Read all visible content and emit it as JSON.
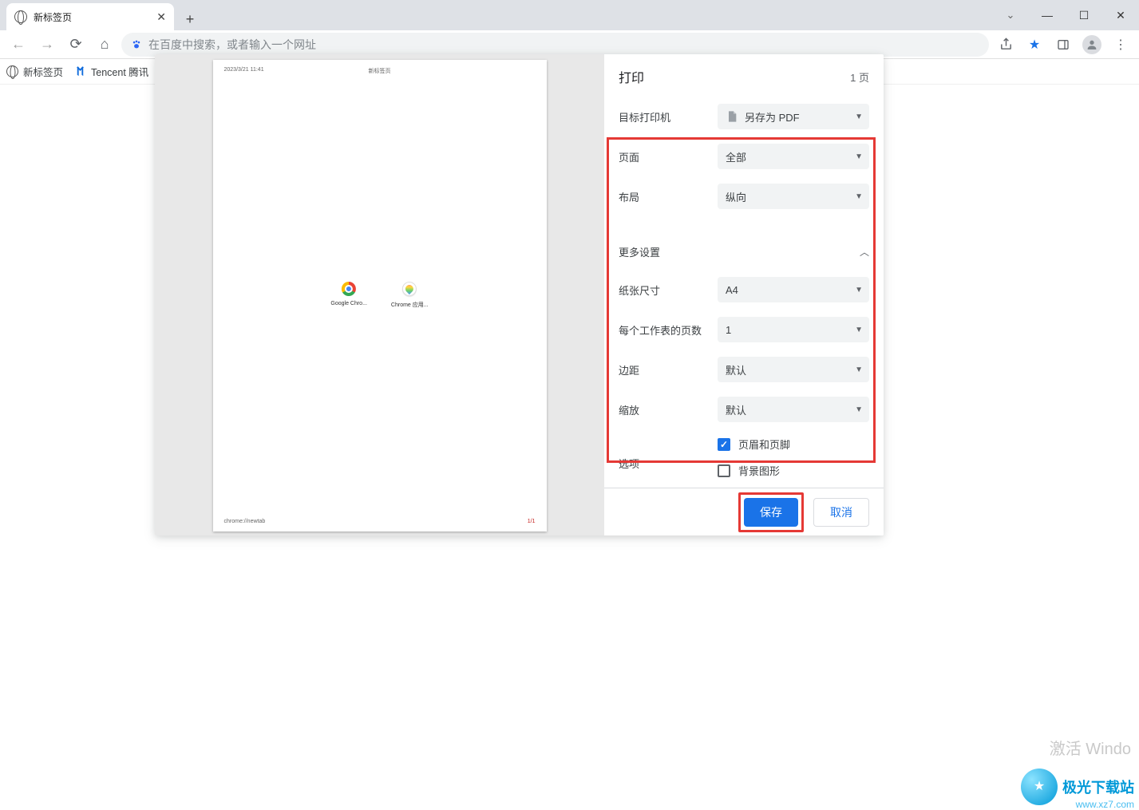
{
  "browser": {
    "tab_title": "新标签页",
    "address_placeholder": "在百度中搜索，或者输入一个网址",
    "bookmarks": [
      {
        "label": "新标签页"
      },
      {
        "label": "Tencent 腾讯"
      }
    ]
  },
  "print": {
    "title": "打印",
    "page_count": "1 页",
    "destination_label": "目标打印机",
    "destination_value": "另存为 PDF",
    "pages_label": "页面",
    "pages_value": "全部",
    "layout_label": "布局",
    "layout_value": "纵向",
    "more_settings": "更多设置",
    "paper_size_label": "纸张尺寸",
    "paper_size_value": "A4",
    "pages_per_sheet_label": "每个工作表的页数",
    "pages_per_sheet_value": "1",
    "margins_label": "边距",
    "margins_value": "默认",
    "scale_label": "缩放",
    "scale_value": "默认",
    "options_label": "选项",
    "option_headers_footers": "页眉和页脚",
    "option_background": "背景图形",
    "save_button": "保存",
    "cancel_button": "取消"
  },
  "preview": {
    "header_date": "2023/3/21 11:41",
    "header_title": "新标签页",
    "shortcut1": "Google Chro...",
    "shortcut2": "Chrome 应用...",
    "footer_url": "chrome://newtab",
    "footer_page": "1/1"
  },
  "watermark": {
    "activate": "激活 Windo",
    "brand": "极光下载站",
    "url": "www.xz7.com"
  }
}
